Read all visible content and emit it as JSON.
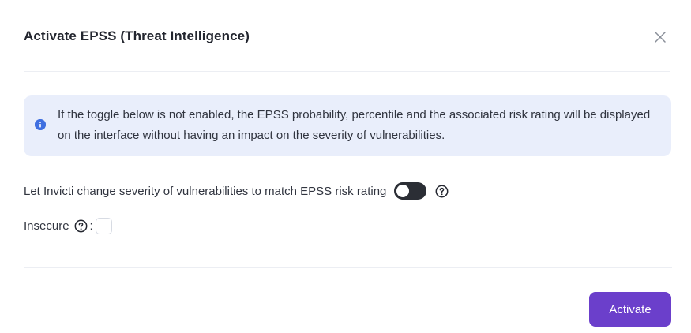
{
  "dialog": {
    "title": "Activate EPSS (Threat Intelligence)",
    "close_icon": "close-icon",
    "info": {
      "icon": "info-icon",
      "text": "If the toggle below is not enabled, the EPSS probability, percentile and the associated risk rating will be displayed on the interface without having an impact on the severity of vulnerabilities."
    },
    "severity_toggle": {
      "label": "Let Invicti change severity of vulnerabilities to match EPSS risk rating",
      "enabled": false,
      "help_icon": "help-circle-icon"
    },
    "insecure": {
      "label": "Insecure",
      "separator": ":",
      "help_icon": "help-circle-icon",
      "checked": false
    },
    "footer": {
      "activate_label": "Activate"
    }
  },
  "colors": {
    "primary": "#6b3fcb",
    "info_background": "#e9eefb",
    "info_icon": "#3f6fe0",
    "toggle_off": "#2b2e35"
  }
}
